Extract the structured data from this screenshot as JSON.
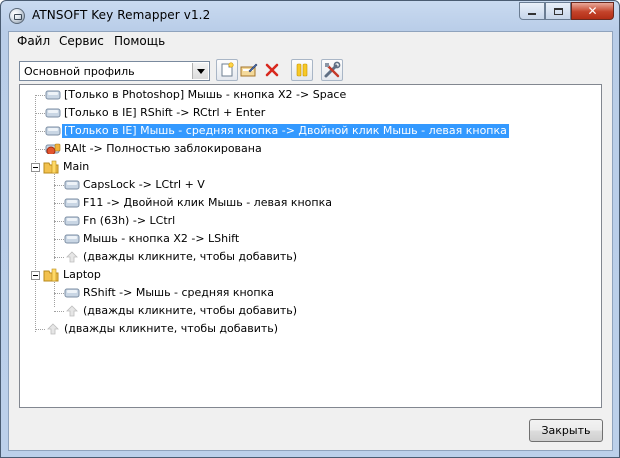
{
  "window": {
    "title": "ATNSOFT Key Remapper v1.2"
  },
  "menu": [
    "Файл",
    "Сервис",
    "Помощь"
  ],
  "toolbar": {
    "profile_value": "Основной профиль"
  },
  "tree": {
    "root": [
      {
        "label": "[Только в Photoshop] Мышь - кнопка X2 -> Space",
        "icon": "key-icon"
      },
      {
        "label": "[Только в IE] RShift -> RCtrl + Enter",
        "icon": "key-icon"
      },
      {
        "label": "[Только в IE] Мышь - средняя кнопка -> Двойной клик Мышь - левая кнопка",
        "icon": "key-icon",
        "selected": true
      },
      {
        "label": "RAlt -> Полностью заблокирована",
        "icon": "blocked-key-icon"
      }
    ],
    "groups": [
      {
        "name": "Main",
        "items": [
          "CapsLock -> LCtrl + V",
          "F11 -> Двойной клик Мышь - левая кнопка",
          "Fn (63h) -> LCtrl",
          "Мышь - кнопка X2 -> LShift"
        ],
        "add_hint": "(дважды кликните, чтобы добавить)"
      },
      {
        "name": "Laptop",
        "items": [
          "RShift -> Мышь - средняя кнопка"
        ],
        "add_hint": "(дважды кликните, чтобы добавить)"
      }
    ],
    "root_add_hint": "(дважды кликните, чтобы добавить)"
  },
  "buttons": {
    "close": "Закрыть"
  },
  "colors": {
    "selection": "#3399ff",
    "title_bar": "#b9cde8",
    "close_button": "#c4432a",
    "folder": "#f2c14e"
  }
}
